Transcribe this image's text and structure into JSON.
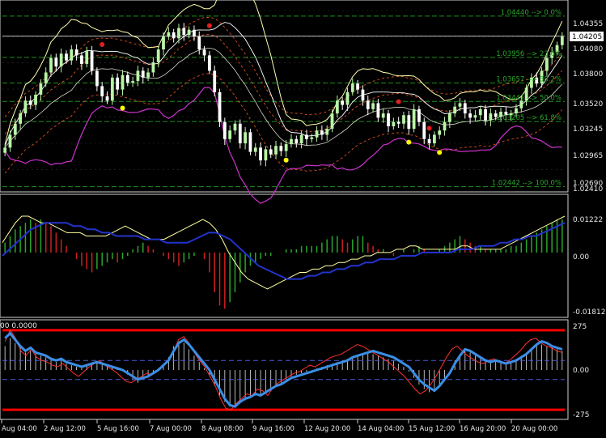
{
  "colors": {
    "background": "#000000",
    "grid": "#2f2f2f",
    "bull_candle": "#b9f5a6",
    "bear_candle": "#ffffff",
    "bollinger_outer": "#ffffb0",
    "bollinger_inner": "#ffffff",
    "envelope": "#e0501e",
    "lower_band": "#cc33cc",
    "fib_level": "#1f8f1f",
    "fractal_up": "#e02020",
    "fractal_down": "#ffff00",
    "macd_signal": "#ffffa0",
    "macd_line": "#2233cc",
    "cci_thick": "#3a8ee6",
    "cci_thin": "#ff3030",
    "cci_hist": "#e6e6e6",
    "level_line": "#ff0000"
  },
  "chart_data": [
    {
      "type": "candlestick",
      "name": "price",
      "ylim": [
        1.0241,
        1.046
      ],
      "y_ticks": [
        "1.04355",
        "1.04080",
        "1.03800",
        "1.03520",
        "1.03245",
        "1.02965",
        "1.02690",
        "1.02410"
      ],
      "current_price": "1.04205",
      "fib_levels": [
        {
          "label": "1.04440 --> 0.0%",
          "price": 1.0444
        },
        {
          "label": "1.03956 --> 23.6%",
          "price": 1.03956
        },
        {
          "label": "1.03657 --> 38.2%",
          "price": 1.03657
        },
        {
          "label": "1.03441 --> 50.0%",
          "price": 1.03441
        },
        {
          "label": "1.03205 --> 61.8%",
          "price": 1.03205
        },
        {
          "label": "1.02442 --> 100.0%",
          "price": 1.02442
        }
      ],
      "close": [
        1.029,
        1.0305,
        1.0318,
        1.033,
        1.0345,
        1.034,
        1.0352,
        1.0365,
        1.0378,
        1.0395,
        1.0385,
        1.04,
        1.0392,
        1.0405,
        1.0398,
        1.0388,
        1.0403,
        1.038,
        1.0362,
        1.035,
        1.0345,
        1.0372,
        1.0358,
        1.0375,
        1.0366,
        1.0368,
        1.038,
        1.0372,
        1.0378,
        1.039,
        1.0405,
        1.042,
        1.0425,
        1.0418,
        1.043,
        1.0422,
        1.0428,
        1.042,
        1.0405,
        1.0398,
        1.038,
        1.0355,
        1.032,
        1.03,
        1.031,
        1.0318,
        1.0295,
        1.0308,
        1.0285,
        1.029,
        1.0275,
        1.0288,
        1.0282,
        1.0292,
        1.0286,
        1.0294,
        1.03,
        1.0295,
        1.0305,
        1.03,
        1.0302,
        1.031,
        1.0305,
        1.0312,
        1.033,
        1.0345,
        1.034,
        1.0355,
        1.0365,
        1.0358,
        1.0345,
        1.0335,
        1.0342,
        1.0325,
        1.033,
        1.0315,
        1.032,
        1.0318,
        1.0328,
        1.0312,
        1.0335,
        1.032,
        1.03,
        1.0295,
        1.0305,
        1.031,
        1.032,
        1.033,
        1.0338,
        1.0342,
        1.033,
        1.0325,
        1.0328,
        1.0335,
        1.0322,
        1.033,
        1.0326,
        1.0332,
        1.0328,
        1.033,
        1.0336,
        1.0345,
        1.036,
        1.0372,
        1.0365,
        1.038,
        1.0395,
        1.0402,
        1.041,
        1.042
      ],
      "fractals_up": [
        {
          "bar": 19,
          "price": 1.0405
        },
        {
          "bar": 40,
          "price": 1.0427
        },
        {
          "bar": 77,
          "price": 1.0338
        },
        {
          "bar": 83,
          "price": 1.0307
        }
      ],
      "fractals_down": [
        {
          "bar": 23,
          "price": 1.0342
        },
        {
          "bar": 55,
          "price": 1.0281
        },
        {
          "bar": 79,
          "price": 1.0302
        },
        {
          "bar": 85,
          "price": 1.029
        }
      ]
    },
    {
      "type": "bar+line",
      "name": "macd",
      "ylim": [
        -0.01812,
        0.01222
      ],
      "y_ticks": [
        "0.01222",
        "0.00",
        "-0.01812"
      ],
      "histogram": [
        0.003,
        0.005,
        0.007,
        0.008,
        0.009,
        0.01,
        0.009,
        0.01,
        0.009,
        0.008,
        0.006,
        0.004,
        0.002,
        0.0,
        -0.002,
        -0.004,
        -0.005,
        -0.006,
        -0.005,
        -0.004,
        -0.003,
        -0.002,
        -0.003,
        -0.002,
        -0.001,
        0.001,
        0.002,
        0.003,
        0.002,
        0.001,
        0.0,
        -0.001,
        -0.002,
        -0.003,
        -0.004,
        -0.003,
        -0.002,
        -0.001,
        0.0,
        -0.002,
        -0.006,
        -0.012,
        -0.016,
        -0.017,
        -0.015,
        -0.012,
        -0.009,
        -0.006,
        -0.004,
        -0.003,
        -0.002,
        -0.001,
        -0.001,
        0.0,
        0.0,
        0.001,
        0.001,
        0.001,
        0.002,
        0.002,
        0.002,
        0.002,
        0.003,
        0.004,
        0.005,
        0.005,
        0.004,
        0.003,
        0.004,
        0.005,
        0.005,
        0.003,
        0.002,
        0.001,
        0.001,
        0.0,
        -0.001,
        0.0,
        0.001,
        0.0,
        0.001,
        0.002,
        0.001,
        0.0,
        0.0,
        0.001,
        0.002,
        0.003,
        0.004,
        0.005,
        0.004,
        0.003,
        0.002,
        0.002,
        0.001,
        0.001,
        0.001,
        0.001,
        0.001,
        0.002,
        0.002,
        0.003,
        0.004,
        0.005,
        0.006,
        0.007,
        0.008,
        0.009,
        0.01,
        0.01
      ],
      "signal_line": [
        0.003,
        0.006,
        0.009,
        0.011,
        0.011,
        0.01,
        0.009,
        0.009,
        0.008,
        0.007,
        0.006,
        0.006,
        0.006,
        0.005,
        0.005,
        0.005,
        0.005,
        0.006,
        0.007,
        0.008,
        0.007,
        0.006,
        0.005,
        0.004,
        0.004,
        0.004,
        0.005,
        0.006,
        0.007,
        0.008,
        0.009,
        0.01,
        0.009,
        0.007,
        0.004,
        0.0,
        -0.003,
        -0.006,
        -0.008,
        -0.009,
        -0.01,
        -0.011,
        -0.01,
        -0.009,
        -0.008,
        -0.007,
        -0.006,
        -0.006,
        -0.005,
        -0.005,
        -0.004,
        -0.004,
        -0.003,
        -0.003,
        -0.002,
        -0.002,
        -0.001,
        -0.001,
        0.0,
        0.0,
        0.0,
        0.001,
        0.001,
        0.002,
        0.002,
        0.001,
        0.001,
        0.001,
        0.001,
        0.001,
        0.001,
        0.002,
        0.002,
        0.001,
        0.001,
        0.001,
        0.001,
        0.001,
        0.002,
        0.003,
        0.004,
        0.005,
        0.006,
        0.007,
        0.008,
        0.009,
        0.01,
        0.011
      ],
      "macd_line": [
        -0.001,
        0.001,
        0.003,
        0.005,
        0.007,
        0.008,
        0.009,
        0.009,
        0.009,
        0.009,
        0.008,
        0.008,
        0.007,
        0.007,
        0.006,
        0.006,
        0.005,
        0.005,
        0.005,
        0.005,
        0.004,
        0.004,
        0.004,
        0.003,
        0.003,
        0.003,
        0.003,
        0.004,
        0.005,
        0.006,
        0.006,
        0.005,
        0.004,
        0.002,
        0.0,
        -0.002,
        -0.004,
        -0.005,
        -0.006,
        -0.007,
        -0.008,
        -0.008,
        -0.008,
        -0.007,
        -0.007,
        -0.006,
        -0.006,
        -0.005,
        -0.005,
        -0.004,
        -0.004,
        -0.003,
        -0.003,
        -0.002,
        -0.002,
        -0.002,
        -0.001,
        -0.001,
        -0.001,
        0.0,
        0.0,
        0.0,
        0.0,
        0.0,
        0.001,
        0.001,
        0.001,
        0.002,
        0.002,
        0.002,
        0.003,
        0.003,
        0.004,
        0.004,
        0.005,
        0.005,
        0.006,
        0.007,
        0.008,
        0.009
      ]
    },
    {
      "type": "bar+line",
      "name": "cci",
      "ylim": [
        -300,
        300
      ],
      "y_ticks": [
        "275",
        "0.00",
        "-275"
      ],
      "header": "00 0.0000",
      "levels": [
        250,
        -250
      ],
      "dashed_levels": [
        60,
        -60
      ],
      "thick_line": [
        200,
        230,
        190,
        150,
        120,
        140,
        110,
        100,
        90,
        70,
        60,
        70,
        50,
        40,
        30,
        20,
        30,
        40,
        50,
        40,
        30,
        20,
        10,
        0,
        -20,
        -40,
        -60,
        -50,
        -40,
        -20,
        0,
        30,
        60,
        120,
        170,
        190,
        160,
        120,
        80,
        40,
        0,
        -60,
        -120,
        -180,
        -220,
        -230,
        -200,
        -180,
        -170,
        -150,
        -160,
        -140,
        -120,
        -100,
        -90,
        -70,
        -50,
        -40,
        -30,
        -20,
        -10,
        0,
        10,
        20,
        30,
        40,
        50,
        60,
        80,
        90,
        100,
        110,
        120,
        110,
        100,
        90,
        80,
        60,
        40,
        20,
        -20,
        -60,
        -90,
        -110,
        -130,
        -100,
        -60,
        -20,
        40,
        90,
        130,
        120,
        100,
        80,
        60,
        50,
        60,
        50,
        40,
        50,
        60,
        80,
        100,
        130,
        160,
        180,
        170,
        150,
        140,
        130
      ],
      "thin_line": [
        180,
        250,
        200,
        120,
        90,
        130,
        80,
        60,
        50,
        30,
        20,
        40,
        10,
        -20,
        -40,
        -10,
        20,
        40,
        60,
        30,
        10,
        -10,
        -40,
        -70,
        -80,
        -60,
        -40,
        -20,
        -30,
        -10,
        20,
        60,
        110,
        190,
        210,
        170,
        110,
        60,
        20,
        -40,
        -100,
        -180,
        -240,
        -250,
        -210,
        -180,
        -150,
        -160,
        -120,
        -130,
        -160,
        -110,
        -80,
        -60,
        -40,
        -20,
        -10,
        10,
        30,
        20,
        40,
        60,
        80,
        90,
        100,
        120,
        140,
        160,
        150,
        130,
        110,
        90,
        70,
        50,
        20,
        -10,
        -40,
        -80,
        -120,
        -150,
        -130,
        -90,
        -40,
        20,
        80,
        130,
        150,
        120,
        90,
        70,
        50,
        40,
        60,
        70,
        50,
        40,
        60,
        90,
        120,
        160,
        190,
        200,
        170,
        150,
        140,
        120,
        110
      ],
      "histogram": [
        150,
        200,
        170,
        140,
        110,
        120,
        100,
        90,
        80,
        60,
        50,
        60,
        40,
        30,
        20,
        20,
        30,
        40,
        50,
        40,
        30,
        20,
        10,
        0,
        -30,
        -60,
        -80,
        -60,
        -40,
        -20,
        10,
        40,
        80,
        150,
        180,
        170,
        130,
        90,
        50,
        10,
        -40,
        -100,
        -160,
        -200,
        -230,
        -230,
        -210,
        -190,
        -170,
        -160,
        -160,
        -140,
        -120,
        -100,
        -80,
        -60,
        -40,
        -30,
        -20,
        -10,
        0,
        10,
        20,
        30,
        40,
        50,
        60,
        70,
        80,
        90,
        100,
        110,
        100,
        90,
        80,
        70,
        60,
        40,
        20,
        -10,
        -50,
        -90,
        -120,
        -140,
        -120,
        -90,
        -50,
        0,
        60,
        100,
        120,
        110,
        90,
        70,
        60,
        50,
        60,
        50,
        40,
        50,
        70,
        90,
        110,
        140,
        160,
        160,
        150,
        140,
        130,
        120
      ],
      "x_ticks": [
        "Aug 04:00",
        "2 Aug 12:00",
        "5 Aug 16:00",
        "7 Aug 00:00",
        "8 Aug 08:00",
        "9 Aug 16:00",
        "12 Aug 20:00",
        "14 Aug 04:00",
        "15 Aug 12:00",
        "16 Aug 20:00",
        "20 Aug 00:00"
      ]
    }
  ]
}
